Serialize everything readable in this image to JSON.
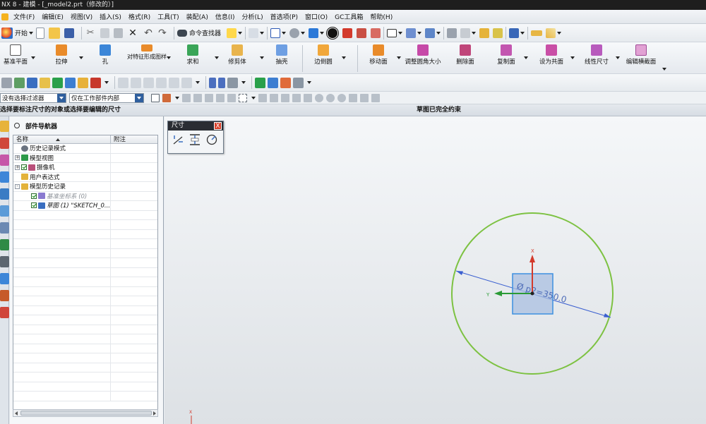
{
  "window": {
    "title": "NX 8 - 建模 - [_model2.prt（修改的）]"
  },
  "menu": {
    "items": [
      "文件(F)",
      "编辑(E)",
      "视图(V)",
      "插入(S)",
      "格式(R)",
      "工具(T)",
      "装配(A)",
      "信息(I)",
      "分析(L)",
      "首选项(P)",
      "窗口(O)",
      "GC工具箱",
      "帮助(H)"
    ]
  },
  "toolbar1": {
    "start_label": "开始",
    "command_finder_label": "命令查找器"
  },
  "ribbon": {
    "buttons": [
      {
        "label": "基准平面"
      },
      {
        "label": "拉伸"
      },
      {
        "label": "孔"
      },
      {
        "label": "对特征形成图样"
      },
      {
        "label": "求和"
      },
      {
        "label": "修剪体"
      },
      {
        "label": "抽壳"
      },
      {
        "label": "边倒圆"
      },
      {
        "label": "移动面"
      },
      {
        "label": "调整圆角大小"
      },
      {
        "label": "删除面"
      },
      {
        "label": "复制面"
      },
      {
        "label": "设为共面"
      },
      {
        "label": "线性尺寸"
      },
      {
        "label": "编辑横截面"
      }
    ]
  },
  "filterbar": {
    "type_filter": "没有选择过滤器",
    "scope_filter": "仅在工作部件内部"
  },
  "cue": {
    "left": "选择要标注尺寸的对象或选择要编辑的尺寸",
    "status": "草图已完全约束"
  },
  "navigator": {
    "title": "部件导航器",
    "col_name": "名称",
    "col_notes": "附注",
    "rows": [
      {
        "label": "历史记录模式",
        "indent": 0,
        "expander": "",
        "check": false,
        "style": "normal"
      },
      {
        "label": "模型视图",
        "indent": 0,
        "expander": "+",
        "check": false,
        "style": "normal"
      },
      {
        "label": "摄像机",
        "indent": 0,
        "expander": "+",
        "check": true,
        "style": "normal"
      },
      {
        "label": "用户表达式",
        "indent": 0,
        "expander": "",
        "check": false,
        "style": "normal"
      },
      {
        "label": "模型历史记录",
        "indent": 0,
        "expander": "-",
        "check": false,
        "style": "normal"
      },
      {
        "label": "基准坐标系 (0)",
        "indent": 1,
        "expander": "",
        "check": true,
        "style": "grey"
      },
      {
        "label": "草图 (1) \"SKETCH_0...",
        "indent": 1,
        "expander": "",
        "check": true,
        "style": "italic"
      }
    ]
  },
  "dimension_palette": {
    "title": "尺寸",
    "close": "X"
  },
  "viewport": {
    "dimension_text": "Ø p2=350.0",
    "axis_x": "X",
    "axis_y": "Y",
    "colors": {
      "circle": "#7dc242",
      "xaxis": "#d33a2c",
      "yaxis": "#2a9a35",
      "dimline": "#3a5fd0",
      "csys": "#3c8fe0"
    }
  }
}
